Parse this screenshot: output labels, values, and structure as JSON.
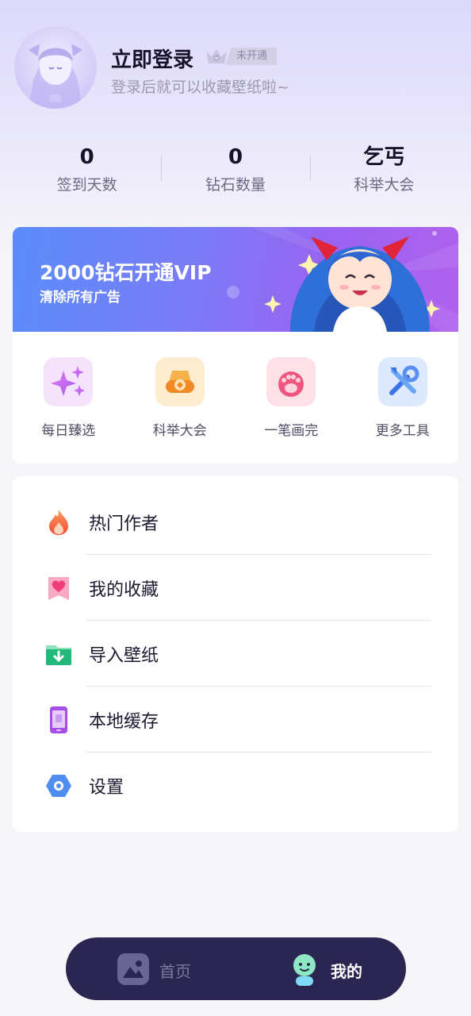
{
  "profile": {
    "title": "立即登录",
    "vip_status": "未开通",
    "subtitle": "登录后就可以收藏壁纸啦~"
  },
  "stats": [
    {
      "value": "0",
      "label": "签到天数"
    },
    {
      "value": "0",
      "label": "钻石数量"
    },
    {
      "value": "乞丐",
      "label": "科举大会"
    }
  ],
  "vip": {
    "title": "2000钻石开通VIP",
    "subtitle": "清除所有广告"
  },
  "tools": [
    {
      "label": "每日臻选",
      "icon": "sparkles-icon",
      "color": "#c56cf0"
    },
    {
      "label": "科举大会",
      "icon": "crown-coin-icon",
      "color": "#f3a23b"
    },
    {
      "label": "一笔画完",
      "icon": "paw-icon",
      "color": "#f0557d"
    },
    {
      "label": "更多工具",
      "icon": "tools-icon",
      "color": "#4f8df0"
    }
  ],
  "menu": [
    {
      "label": "热门作者",
      "icon": "flame-icon"
    },
    {
      "label": "我的收藏",
      "icon": "heart-bookmark-icon"
    },
    {
      "label": "导入壁纸",
      "icon": "folder-download-icon"
    },
    {
      "label": "本地缓存",
      "icon": "phone-storage-icon"
    },
    {
      "label": "设置",
      "icon": "settings-hexagon-icon"
    }
  ],
  "nav": {
    "home": "首页",
    "mine": "我的"
  },
  "colors": {
    "accent": "#2a2551",
    "vip_gradient_start": "#5b8dfa",
    "vip_gradient_end": "#b061ee"
  }
}
